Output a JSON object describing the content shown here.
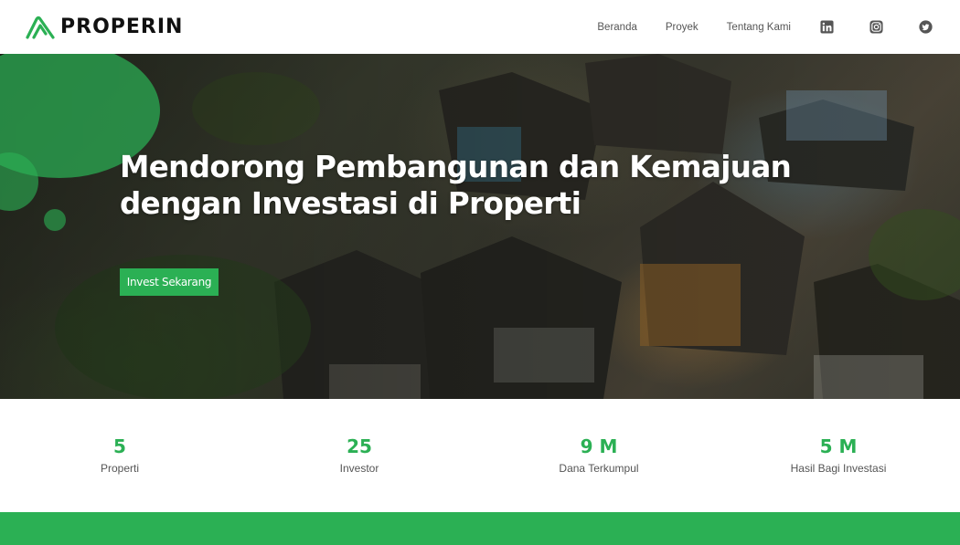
{
  "brand": {
    "name": "PROPERIN",
    "accent_color": "#2bb054"
  },
  "nav": {
    "links": [
      "Beranda",
      "Proyek",
      "Tentang Kami"
    ],
    "social_icons": [
      "linkedin-icon",
      "instagram-icon",
      "twitter-icon"
    ]
  },
  "hero": {
    "title": "Mendorong Pembangunan dan Kemajuan dengan Investasi di Properti",
    "cta_label": "Invest Sekarang"
  },
  "stats": [
    {
      "value": "5",
      "label": "Properti"
    },
    {
      "value": "25",
      "label": "Investor"
    },
    {
      "value": "9 M",
      "label": "Dana Terkumpul"
    },
    {
      "value": "5 M",
      "label": "Hasil Bagi Investasi"
    }
  ]
}
